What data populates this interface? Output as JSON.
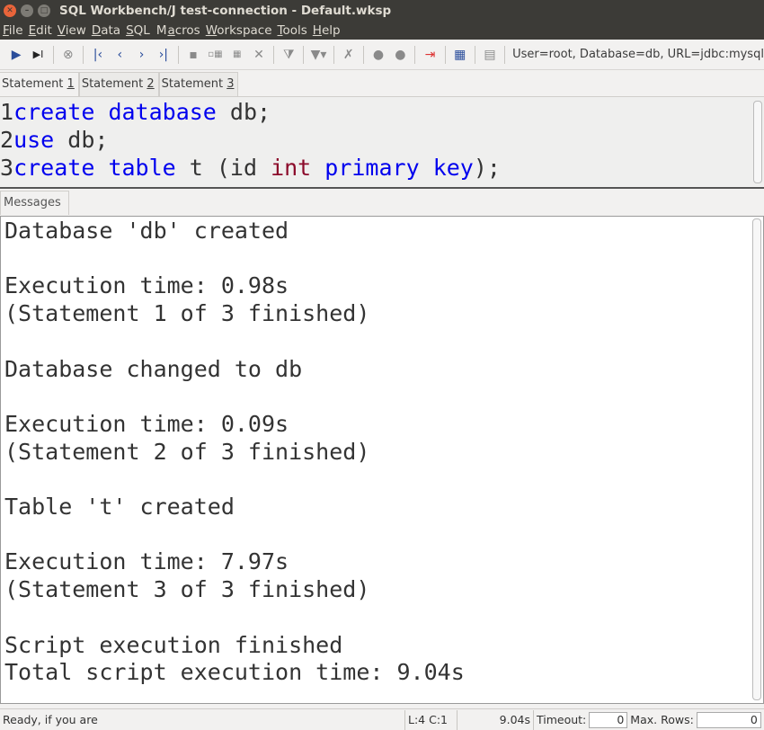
{
  "window": {
    "title": "SQL Workbench/J test-connection - Default.wksp"
  },
  "menu": [
    {
      "u": "F",
      "rest": "ile"
    },
    {
      "u": "E",
      "rest": "dit"
    },
    {
      "u": "V",
      "rest": "iew"
    },
    {
      "u": "D",
      "rest": "ata"
    },
    {
      "u": "S",
      "rest": "QL"
    },
    {
      "pre": "M",
      "u": "a",
      "rest": "cros"
    },
    {
      "u": "W",
      "rest": "orkspace"
    },
    {
      "u": "T",
      "rest": "ools"
    },
    {
      "u": "H",
      "rest": "elp"
    }
  ],
  "toolbar": {
    "connection_info": "User=root, Database=db, URL=jdbc:mysql"
  },
  "tabs": [
    {
      "label": "Statement ",
      "num": "1"
    },
    {
      "label": "Statement ",
      "num": "2"
    },
    {
      "label": "Statement ",
      "num": "3"
    }
  ],
  "editor": {
    "lines": [
      {
        "n": "1",
        "tokens": [
          {
            "t": "create",
            "c": "kw"
          },
          {
            "t": " "
          },
          {
            "t": "database",
            "c": "kw"
          },
          {
            "t": " db;"
          }
        ]
      },
      {
        "n": "2",
        "tokens": [
          {
            "t": "use",
            "c": "kw"
          },
          {
            "t": " db;"
          }
        ]
      },
      {
        "n": "3",
        "tokens": [
          {
            "t": "create",
            "c": "kw"
          },
          {
            "t": " "
          },
          {
            "t": "table",
            "c": "kw"
          },
          {
            "t": " t (id "
          },
          {
            "t": "int",
            "c": "ty"
          },
          {
            "t": " "
          },
          {
            "t": "primary",
            "c": "kw"
          },
          {
            "t": " "
          },
          {
            "t": "key",
            "c": "kw"
          },
          {
            "t": ");"
          }
        ]
      }
    ]
  },
  "messages_tab": "Messages",
  "messages": "Database 'db' created\n\nExecution time: 0.98s\n(Statement 1 of 3 finished)\n\nDatabase changed to db\n\nExecution time: 0.09s\n(Statement 2 of 3 finished)\n\nTable 't' created\n\nExecution time: 7.97s\n(Statement 3 of 3 finished)\n\nScript execution finished\nTotal script execution time: 9.04s",
  "status": {
    "text": "Ready, if you are",
    "cursor": "L:4 C:1",
    "time": "9.04s",
    "timeout_label": "Timeout:",
    "timeout_value": "0",
    "maxrows_label": "Max. Rows:",
    "maxrows_value": "0"
  }
}
